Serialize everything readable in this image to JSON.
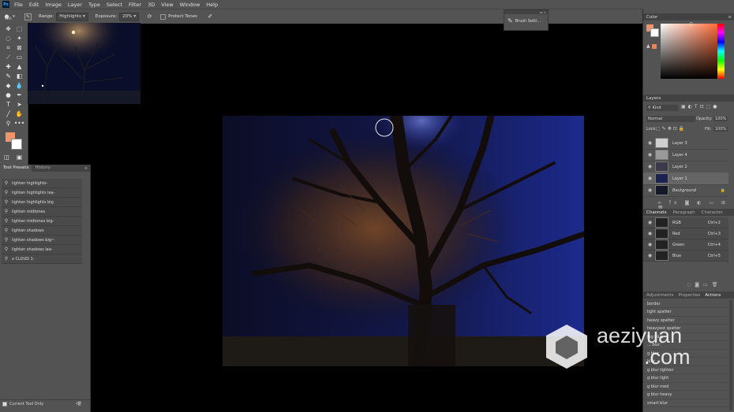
{
  "menu": [
    "File",
    "Edit",
    "Image",
    "Layer",
    "Type",
    "Select",
    "Filter",
    "3D",
    "View",
    "Window",
    "Help"
  ],
  "app_logo": "Ps",
  "options": {
    "brush_size": "100",
    "range_label": "Range:",
    "range_value": "Highlights",
    "exposure_label": "Exposure:",
    "exposure_value": "20%",
    "protect_tones_label": "Protect Tones"
  },
  "brush_settings_label": "Brush Setti...",
  "tool_presets": {
    "tabs": [
      "Tool Presets",
      "History"
    ],
    "items": [
      "lighten highlights-",
      "lighten highlights lea-",
      "lighten highlights big",
      "lighten midtones",
      "lighten midtones big-",
      "lighten shadows",
      "lighten shadows big~",
      "lighten shadows lea-",
      "x CLOUD 1-"
    ],
    "footer_label": "Current Tool Only"
  },
  "color_panel": {
    "title": "Color",
    "fg": "#f0956a",
    "bg": "#ffffff",
    "accent": "#e8865a"
  },
  "layers_panel": {
    "title": "Layers",
    "filter_kind": "Kind",
    "blend_mode": "Normal",
    "opacity_label": "Opacity:",
    "opacity_value": "100%",
    "lock_label": "Lock:",
    "fill_label": "Fill:",
    "fill_value": "100%",
    "layers": [
      "Layer 3",
      "Layer 4",
      "Layer 2",
      "Layer 1",
      "Background"
    ]
  },
  "channels_panel": {
    "tabs": [
      "Channels",
      "Paragraph",
      "Character"
    ],
    "channels": [
      {
        "name": "RGB",
        "shortcut": "Ctrl+2"
      },
      {
        "name": "Red",
        "shortcut": "Ctrl+3"
      },
      {
        "name": "Green",
        "shortcut": "Ctrl+4"
      },
      {
        "name": "Blue",
        "shortcut": "Ctrl+5"
      }
    ]
  },
  "actions_panel": {
    "tabs": [
      "Adjustments",
      "Properties",
      "Actions"
    ],
    "actions": [
      "border",
      "light spatter",
      "heavy spatter",
      "heavyest spatter",
      "big blue",
      "... blur",
      "g blur",
      "blur",
      "g blur lighten",
      "g blur light",
      "g blur med",
      "g blur heavy",
      "smart blur"
    ]
  },
  "watermark": {
    "name": "aeziyuan",
    "domain": ".com"
  }
}
